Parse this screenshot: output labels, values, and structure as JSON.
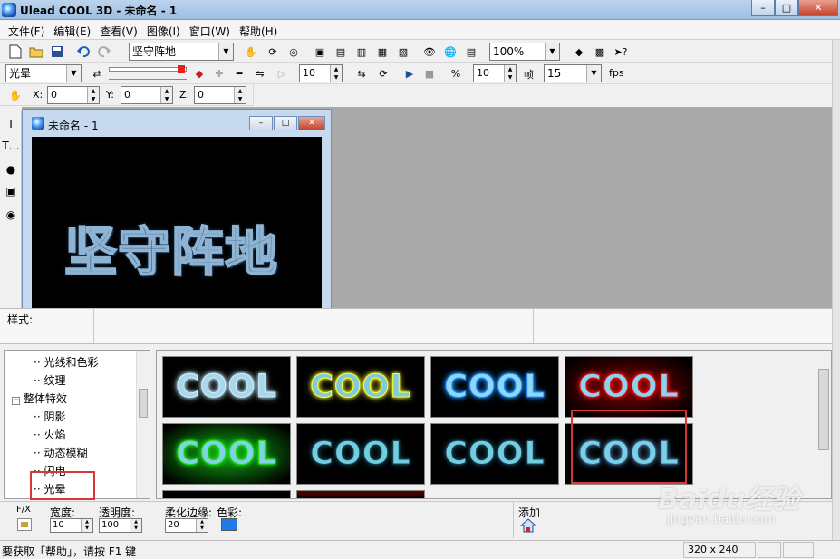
{
  "window": {
    "title": "Ulead COOL 3D - 未命名 - 1"
  },
  "menu": {
    "items": [
      "文件(F)",
      "编辑(E)",
      "查看(V)",
      "图像(I)",
      "窗口(W)",
      "帮助(H)"
    ]
  },
  "toolbar1": {
    "text_object": "坚守阵地",
    "zoom": "100%"
  },
  "toolbar2": {
    "effect": "光晕",
    "frame_value": "10",
    "speed_value": "10",
    "frame_label": "帧",
    "fps_value": "15",
    "fps_label": "fps"
  },
  "toolbar3": {
    "x_label": "X:",
    "x_value": "0",
    "y_label": "Y:",
    "y_value": "0",
    "z_label": "Z:",
    "z_value": "0"
  },
  "document": {
    "title": "未命名 - 1",
    "canvas_text": "坚守阵地"
  },
  "style_panel": {
    "label": "样式:"
  },
  "tree": {
    "items": [
      {
        "label": "光线和色彩"
      },
      {
        "label": "纹理"
      },
      {
        "label": "整体特效",
        "expander": "−"
      },
      {
        "label": "阴影"
      },
      {
        "label": "火焰"
      },
      {
        "label": "动态模糊"
      },
      {
        "label": "闪电"
      },
      {
        "label": "光晕"
      }
    ]
  },
  "gallery": {
    "items": [
      {
        "label": "COOL",
        "fill": "#a9d7ea",
        "glow": "#c9eeff",
        "bg": "#000000"
      },
      {
        "label": "COOL",
        "fill": "#7fcbdc",
        "glow": "#ffff32",
        "bg": "#000000"
      },
      {
        "label": "COOL",
        "fill": "#8fd8f5",
        "glow": "#1e90ff",
        "bg": "#000000"
      },
      {
        "label": "COOL",
        "fill": "#8cd3f0",
        "glow": "#e01010",
        "bg": "#7a0000"
      },
      {
        "label": "COOL",
        "fill": "#7fd3e3",
        "glow": "#22dd22",
        "bg": "#11aa11"
      },
      {
        "label": "COOL",
        "fill": "#72cde0",
        "glow": "#16404c",
        "bg": "#000000"
      },
      {
        "label": "COOL",
        "fill": "#72cde0",
        "glow": "#1a3f52",
        "bg": "#000000"
      },
      {
        "label": "COOL",
        "fill": "#79d0e8",
        "glow": "#3a5f80",
        "bg": "#000000"
      }
    ]
  },
  "properties": {
    "fx_label": "F/X",
    "width_label": "宽度:",
    "width_value": "10",
    "opacity_label": "透明度:",
    "opacity_value": "100",
    "feather_label": "柔化边缘:",
    "feather_value": "20",
    "color_label": "色彩:",
    "color": "#1f7be6",
    "add_label": "添加"
  },
  "status": {
    "help_text": "要获取「帮助」，请按 F1 键",
    "size": "320 x 240"
  },
  "watermark": {
    "text": "Baidu经验",
    "sub": "jingyan.baidu.com"
  },
  "colors": {
    "highlight": "#d9363a"
  }
}
